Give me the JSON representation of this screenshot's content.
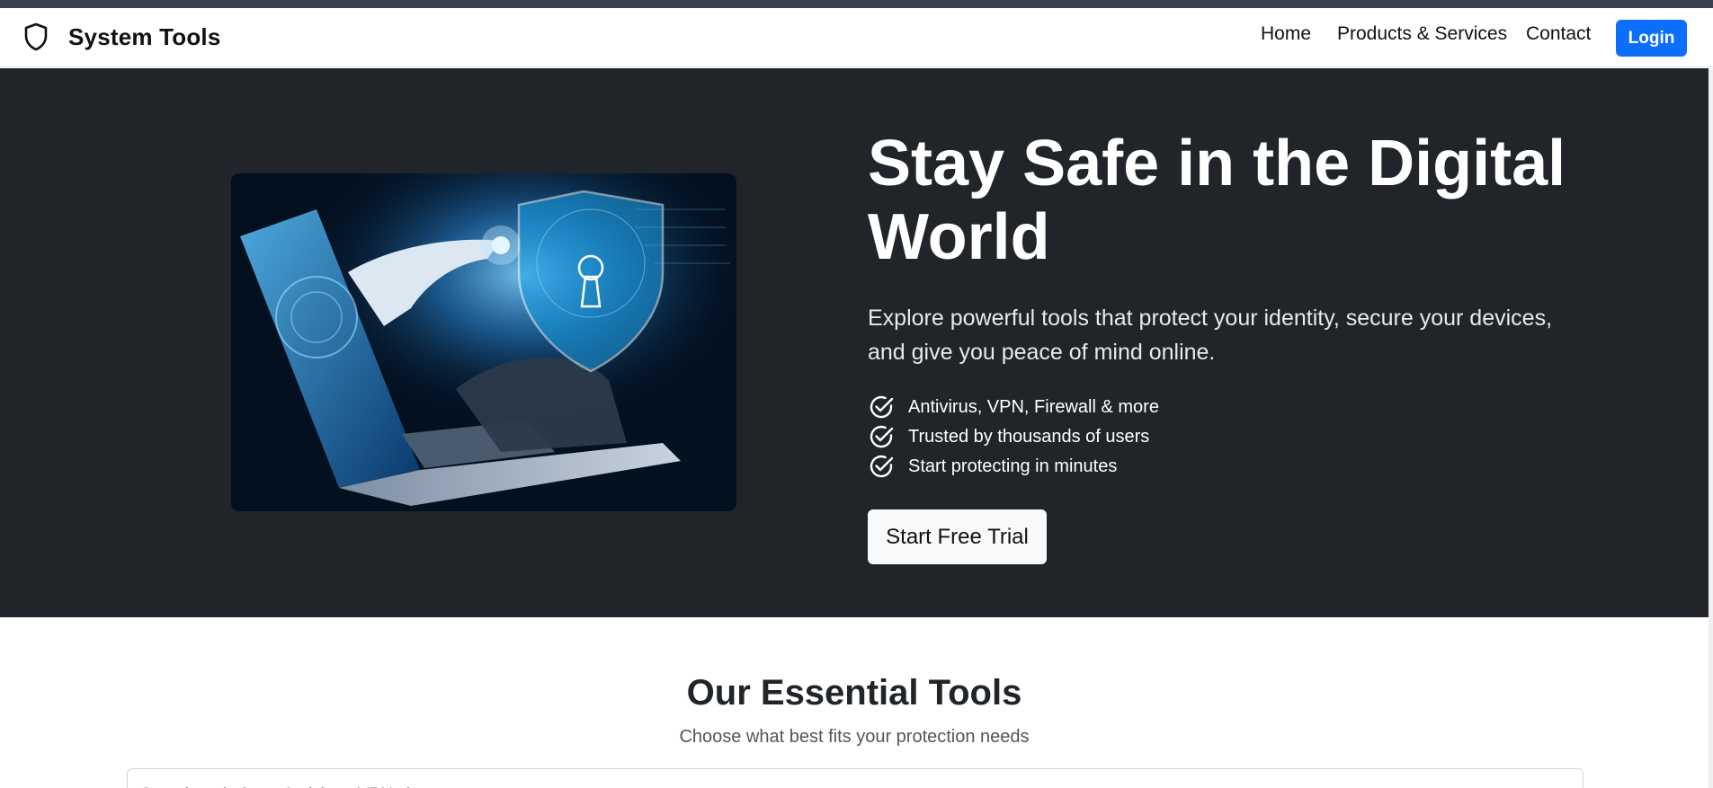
{
  "brand": {
    "name": "System Tools",
    "icon": "shield-icon"
  },
  "nav": {
    "items": [
      {
        "label": "Home"
      },
      {
        "label": "Products & Services"
      },
      {
        "label": "Contact"
      }
    ],
    "login_label": "Login"
  },
  "hero": {
    "title": "Stay Safe in the Digital World",
    "subtitle": "Explore powerful tools that protect your identity, secure your devices, and give you peace of mind online.",
    "features": [
      {
        "text": "Antivirus, VPN, Firewall & more",
        "icon": "check-circle-icon"
      },
      {
        "text": "Trusted by thousands of users",
        "icon": "check-circle-icon"
      },
      {
        "text": "Start protecting in minutes",
        "icon": "check-circle-icon"
      }
    ],
    "cta_label": "Start Free Trial",
    "image": "robot-hand-shield-laptop-image"
  },
  "tools": {
    "title": "Our Essential Tools",
    "subtitle": "Choose what best fits your protection needs",
    "search_placeholder": "Search tools (e.g., Antivirus, VPN...)"
  },
  "colors": {
    "hero_bg": "#212529",
    "primary": "#0d6efd",
    "light_button": "#f8f9fa"
  }
}
